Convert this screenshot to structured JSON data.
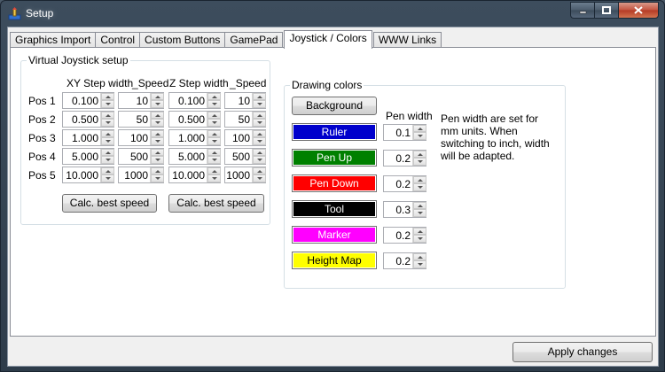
{
  "window": {
    "title": "Setup"
  },
  "tabs": [
    {
      "label": "Graphics Import"
    },
    {
      "label": "Control"
    },
    {
      "label": "Custom Buttons"
    },
    {
      "label": "GamePad"
    },
    {
      "label": "Joystick / Colors",
      "active": true
    },
    {
      "label": "WWW Links"
    }
  ],
  "joystick": {
    "title": "Virtual Joystick setup",
    "headers": {
      "xy_step": "XY Step width",
      "xy_speed": "Speed",
      "z_step": "Z Step width",
      "z_speed": "Speed"
    },
    "rows": [
      {
        "label": "Pos 1",
        "xy_step": "0.100",
        "xy_speed": "10",
        "z_step": "0.100",
        "z_speed": "10"
      },
      {
        "label": "Pos 2",
        "xy_step": "0.500",
        "xy_speed": "50",
        "z_step": "0.500",
        "z_speed": "50"
      },
      {
        "label": "Pos 3",
        "xy_step": "1.000",
        "xy_speed": "100",
        "z_step": "1.000",
        "z_speed": "100"
      },
      {
        "label": "Pos 4",
        "xy_step": "5.000",
        "xy_speed": "500",
        "z_step": "5.000",
        "z_speed": "500"
      },
      {
        "label": "Pos 5",
        "xy_step": "10.000",
        "xy_speed": "1000",
        "z_step": "10.000",
        "z_speed": "1000"
      }
    ],
    "calc_xy_label": "Calc. best speed",
    "calc_z_label": "Calc. best speed"
  },
  "colors": {
    "title": "Drawing colors",
    "background_label": "Background",
    "pen_width_header": "Pen width",
    "note": "Pen width are set for mm units. When switching to inch, width will be adapted.",
    "items": [
      {
        "label": "Ruler",
        "color": "#0000cc",
        "text_color": "#ffffff",
        "pen_width": "0.1"
      },
      {
        "label": "Pen Up",
        "color": "#008000",
        "text_color": "#ffffff",
        "pen_width": "0.2"
      },
      {
        "label": "Pen Down",
        "color": "#ff0000",
        "text_color": "#ffffff",
        "pen_width": "0.2"
      },
      {
        "label": "Tool",
        "color": "#000000",
        "text_color": "#ffffff",
        "pen_width": "0.3"
      },
      {
        "label": "Marker",
        "color": "#ff00ff",
        "text_color": "#ffffff",
        "pen_width": "0.2"
      },
      {
        "label": "Height Map",
        "color": "#ffff00",
        "text_color": "#000000",
        "pen_width": "0.2"
      }
    ]
  },
  "footer": {
    "apply_label": "Apply changes"
  }
}
